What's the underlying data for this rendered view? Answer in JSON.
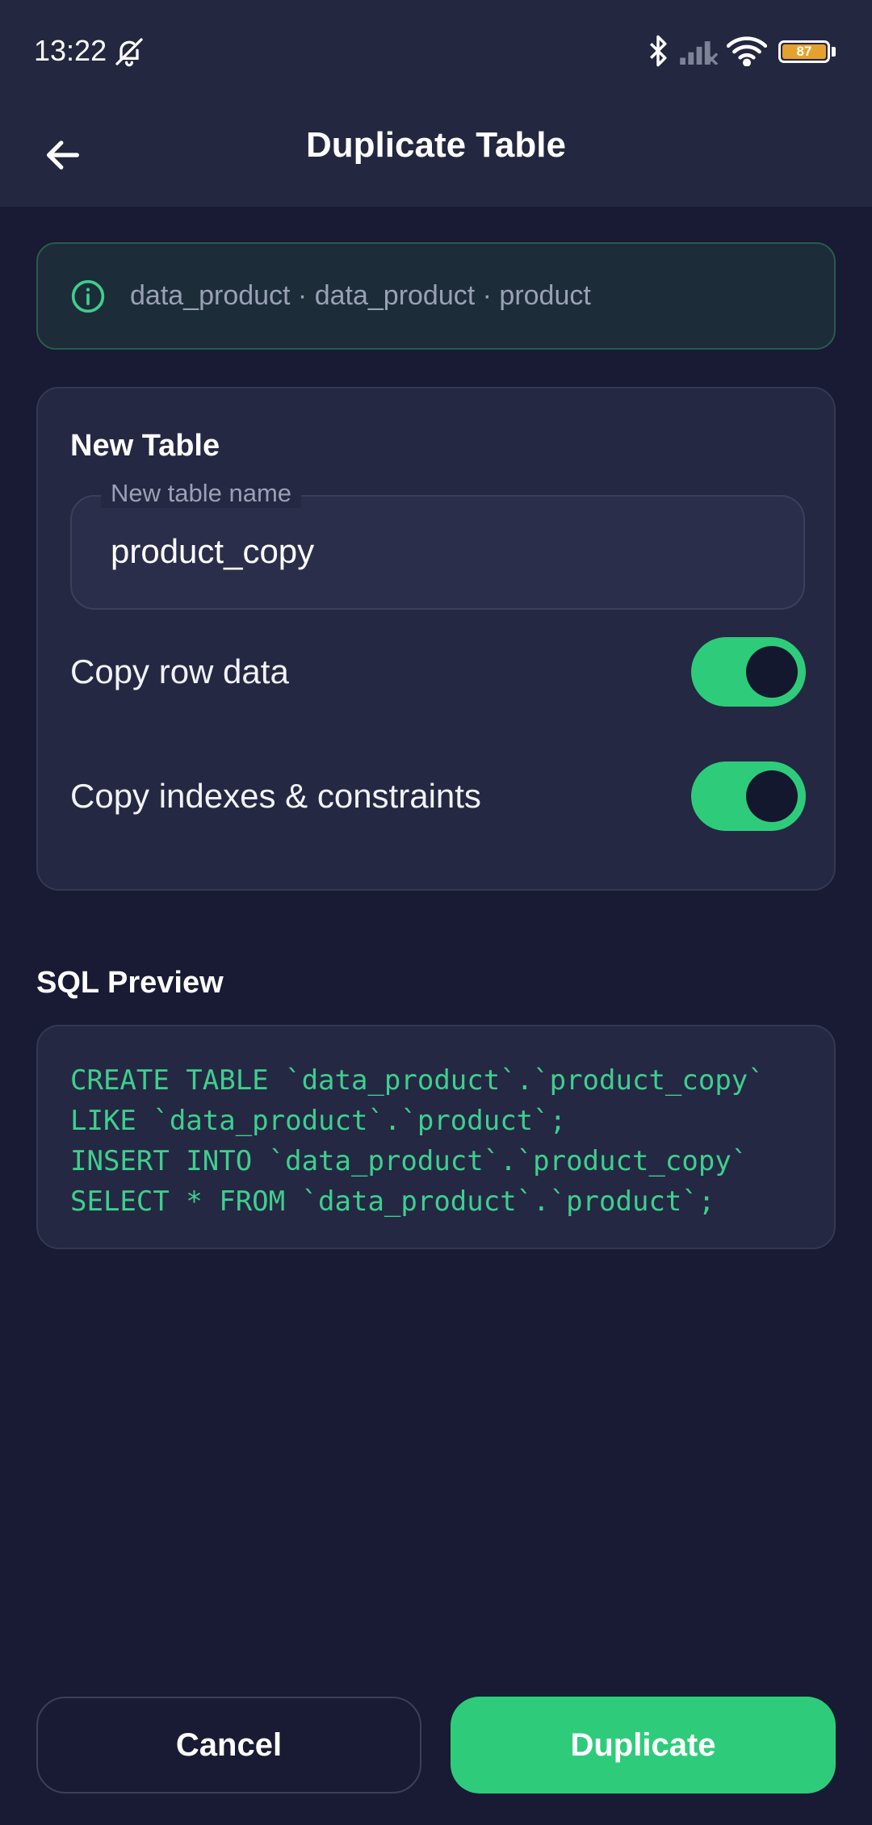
{
  "status_bar": {
    "time": "13:22",
    "battery_level": "87",
    "icons": [
      "bell-off-icon",
      "bluetooth-icon",
      "signal-icon",
      "wifi-icon",
      "battery-icon"
    ]
  },
  "app_bar": {
    "title": "Duplicate Table",
    "back_icon": "arrow-left-icon"
  },
  "info_banner": {
    "icon": "info-icon",
    "text": "data_product · data_product · product"
  },
  "new_table_card": {
    "title": "New Table",
    "name_field": {
      "label": "New table name",
      "value": "product_copy"
    },
    "options": [
      {
        "label": "Copy row data",
        "enabled": true
      },
      {
        "label": "Copy indexes & constraints",
        "enabled": true
      }
    ]
  },
  "sql_preview": {
    "title": "SQL Preview",
    "lines": [
      "CREATE TABLE `data_product`.`product_copy`",
      "LIKE `data_product`.`product`;",
      "INSERT INTO `data_product`.`product_copy`",
      "SELECT * FROM `data_product`.`product`;"
    ]
  },
  "actions": {
    "cancel_label": "Cancel",
    "duplicate_label": "Duplicate"
  },
  "colors": {
    "accent": "#2ecc7a",
    "background": "#181b33",
    "surface": "#242843",
    "sql_text": "#3ecf8e"
  }
}
